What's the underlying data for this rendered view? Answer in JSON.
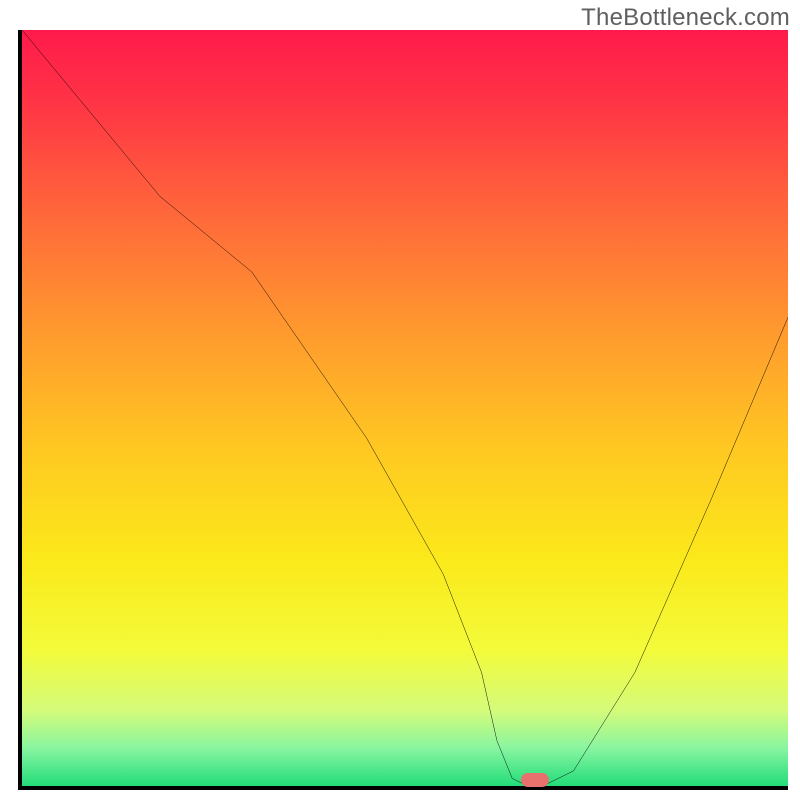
{
  "watermark": "TheBottleneck.com",
  "chart_data": {
    "type": "line",
    "title": "",
    "xlabel": "",
    "ylabel": "",
    "xlim": [
      0,
      100
    ],
    "ylim": [
      0,
      100
    ],
    "grid": false,
    "series": [
      {
        "name": "curve",
        "x": [
          0,
          18,
          30,
          45,
          55,
          60,
          62,
          64,
          66,
          68,
          72,
          80,
          90,
          100
        ],
        "values": [
          100,
          78,
          68,
          46,
          28,
          15,
          6,
          1,
          0,
          0,
          2,
          15,
          38,
          62
        ]
      }
    ],
    "marker": {
      "x": 67,
      "y": 0.8,
      "color": "#e8716d"
    },
    "gradient_stops": [
      {
        "pos": 0.0,
        "color": "#ff1a4b"
      },
      {
        "pos": 0.1,
        "color": "#ff3545"
      },
      {
        "pos": 0.25,
        "color": "#ff6a3a"
      },
      {
        "pos": 0.4,
        "color": "#ff9a2e"
      },
      {
        "pos": 0.55,
        "color": "#ffc722"
      },
      {
        "pos": 0.7,
        "color": "#fbe91a"
      },
      {
        "pos": 0.82,
        "color": "#f3fb3a"
      },
      {
        "pos": 0.9,
        "color": "#d4fb7a"
      },
      {
        "pos": 0.95,
        "color": "#88f5a0"
      },
      {
        "pos": 1.0,
        "color": "#22dc7a"
      }
    ]
  }
}
